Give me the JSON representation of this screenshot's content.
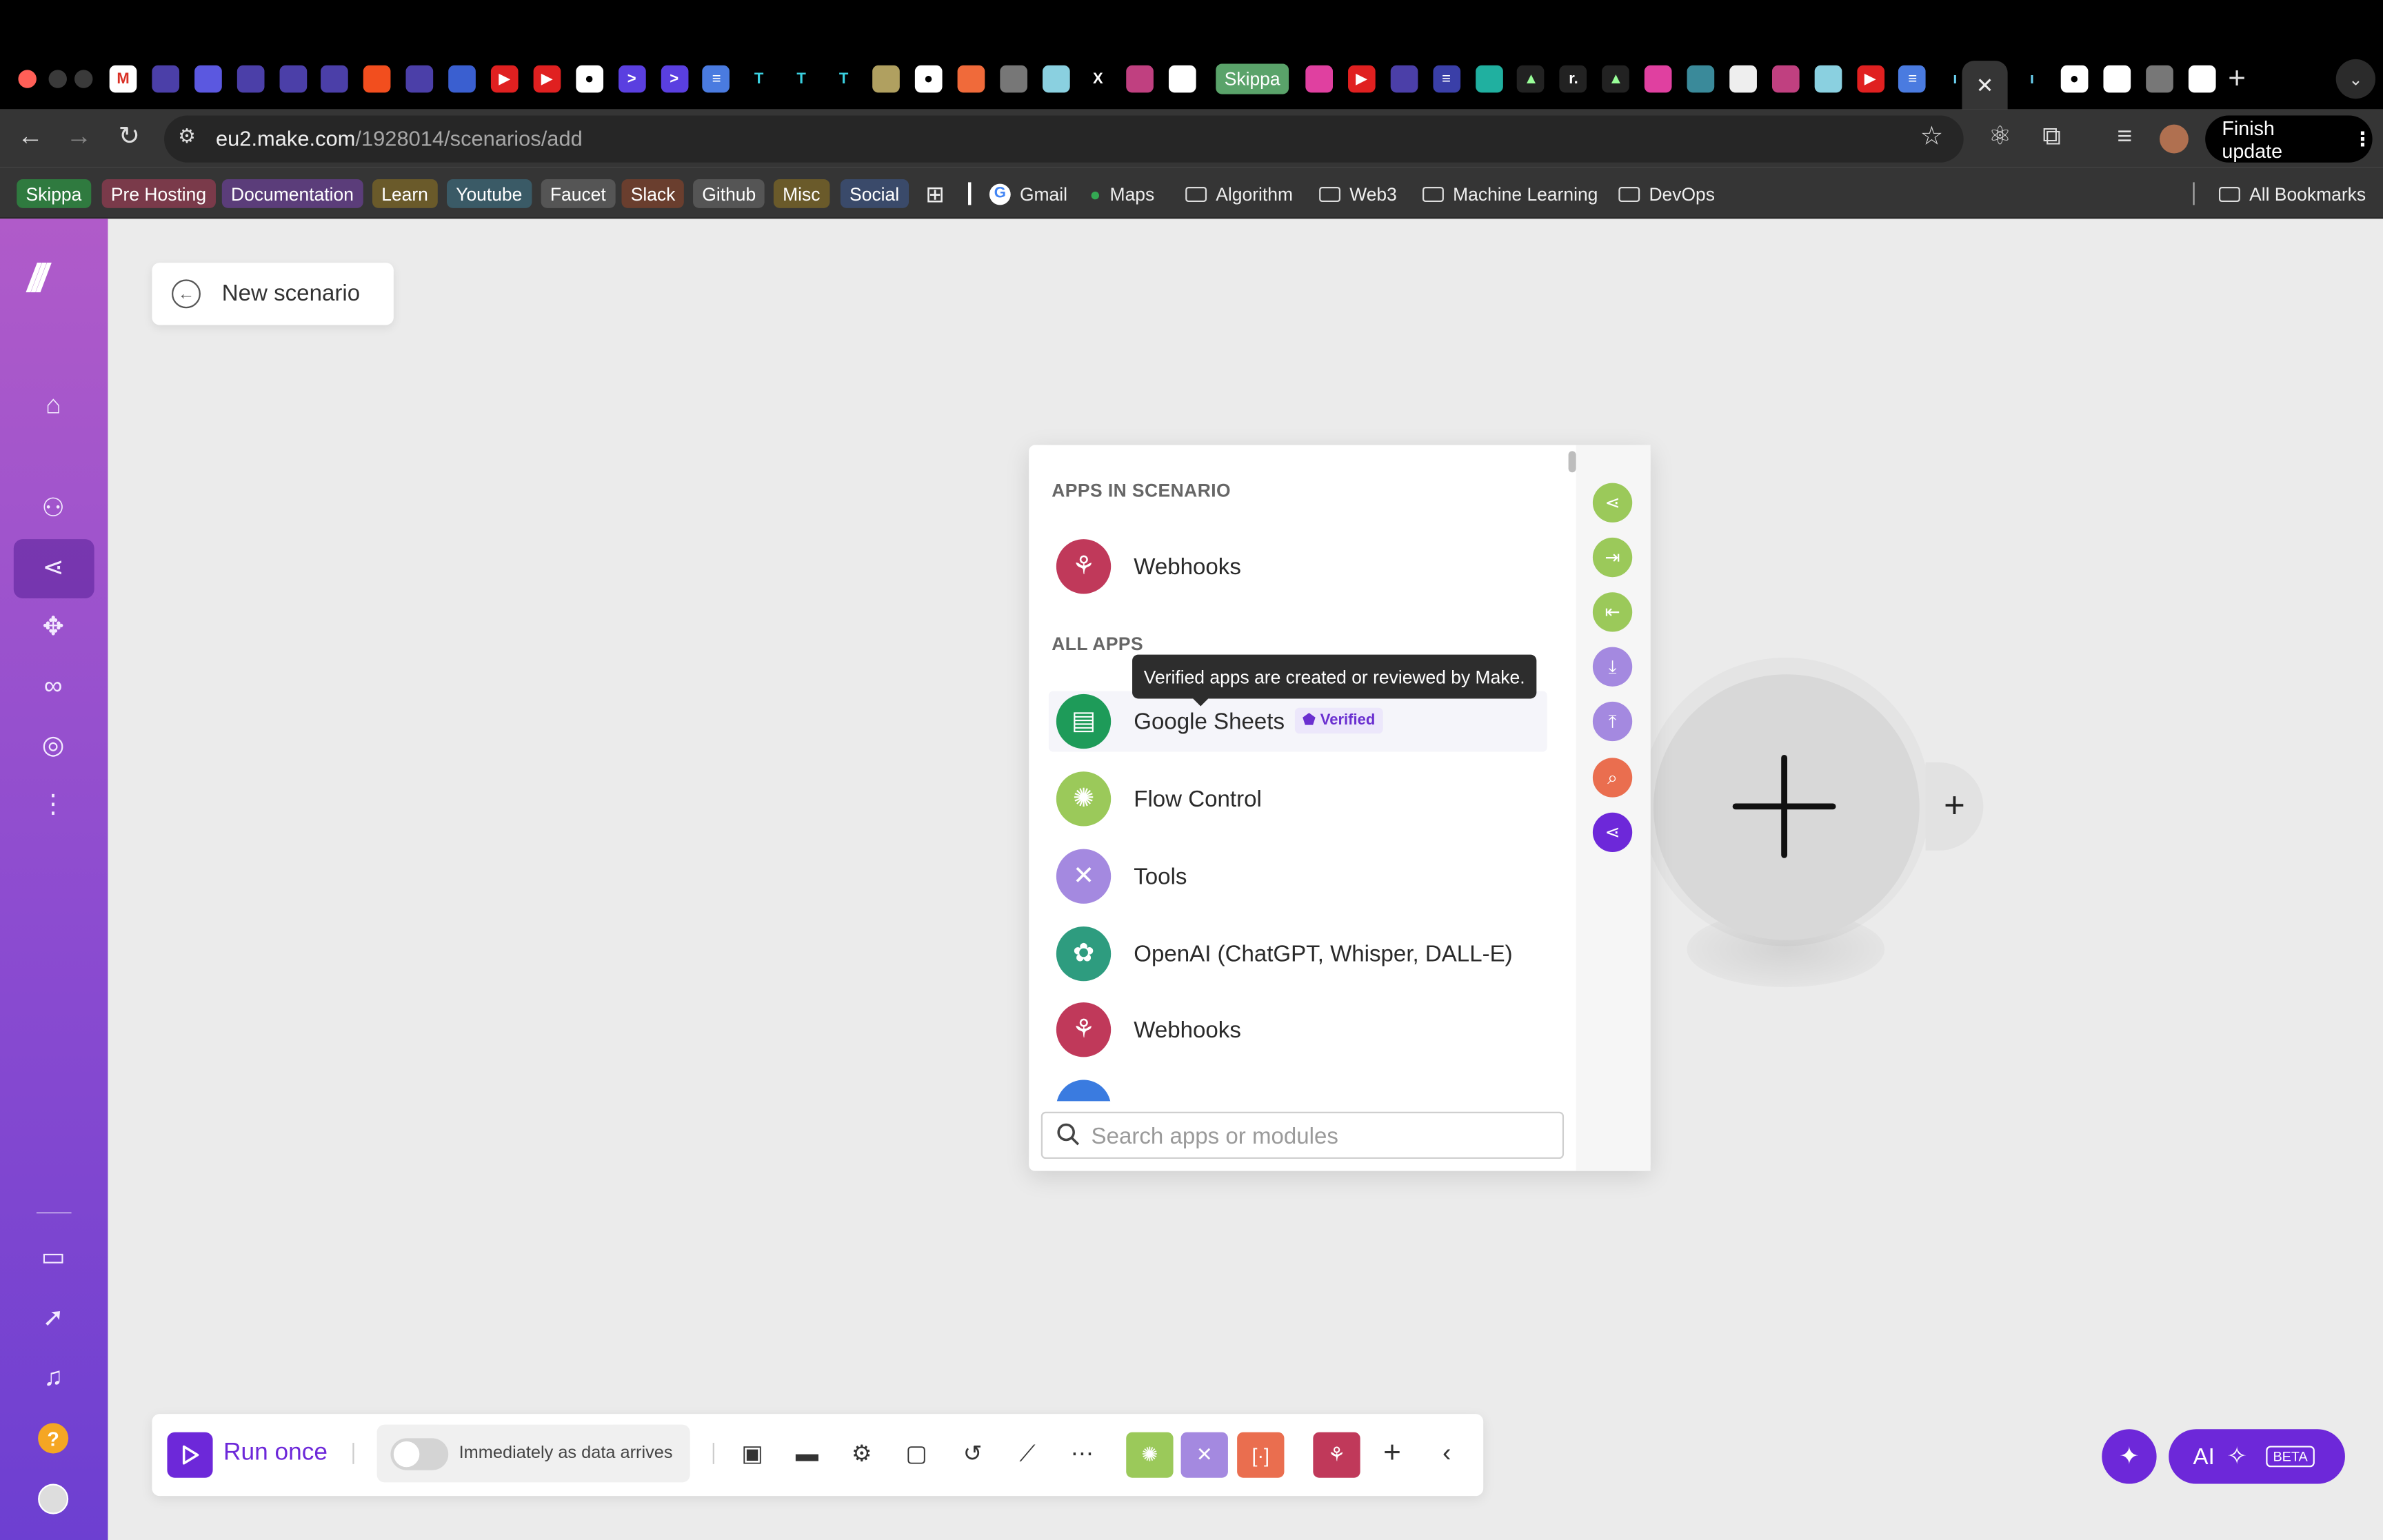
{
  "browser": {
    "url_host": "eu2.make.com",
    "url_path": "/1928014/scenarios/add",
    "finish_update_label": "Finish update",
    "tab_badge": "Skippa",
    "bookmarks": [
      {
        "label": "Skippa",
        "color": "#2f7a3f"
      },
      {
        "label": "Pre Hosting",
        "color": "#7a3a4a"
      },
      {
        "label": "Documentation",
        "color": "#5b3d7a"
      },
      {
        "label": "Learn",
        "color": "#6a5a2a"
      },
      {
        "label": "Youtube",
        "color": "#3a5a66"
      },
      {
        "label": "Faucet",
        "color": "#555555"
      },
      {
        "label": "Slack",
        "color": "#6a3e2e"
      },
      {
        "label": "Github",
        "color": "#555555"
      },
      {
        "label": "Misc",
        "color": "#6a5a2a"
      },
      {
        "label": "Social",
        "color": "#3a4a6a"
      }
    ],
    "bookmark_links": [
      "Gmail",
      "Maps"
    ],
    "bookmark_folders": [
      "Algorithm",
      "Web3",
      "Machine Learning",
      "DevOps"
    ],
    "all_bookmarks_label": "All Bookmarks"
  },
  "scenario": {
    "back_label": "New scenario"
  },
  "picker": {
    "apps_in_scenario_heading": "APPS IN SCENARIO",
    "all_apps_heading": "ALL APPS",
    "scenario_apps": [
      {
        "name": "Webhooks",
        "icon": "webhook-icon",
        "color": "#c0395a"
      }
    ],
    "apps": [
      {
        "name": "Google Sheets",
        "icon": "sheets-icon",
        "color": "#1e9b59",
        "verified": true
      },
      {
        "name": "Flow Control",
        "icon": "gear-icon",
        "color": "#9bc95a"
      },
      {
        "name": "Tools",
        "icon": "tools-icon",
        "color": "#a489e0"
      },
      {
        "name": "OpenAI (ChatGPT, Whisper, DALL-E)",
        "icon": "openai-icon",
        "color": "#2e9c7f"
      },
      {
        "name": "Webhooks",
        "icon": "webhook-icon",
        "color": "#c0395a"
      }
    ],
    "verified_label": "Verified",
    "tooltip": "Verified apps are created or reviewed by Make.",
    "search_placeholder": "Search apps or modules"
  },
  "toolbar": {
    "run_once_label": "Run once",
    "schedule_label": "Immediately as data arrives",
    "schedule_enabled": false,
    "icons": [
      "save-icon",
      "explain-flow-icon",
      "settings-icon",
      "notes-icon",
      "undo-icon",
      "magic-wand-icon",
      "more-icon"
    ],
    "favorite_apps": [
      {
        "icon": "flow-control-icon",
        "color": "#9bc95a"
      },
      {
        "icon": "tools-icon",
        "color": "#a489e0"
      },
      {
        "icon": "text-parser-icon",
        "color": "#ea6e4f"
      },
      {
        "icon": "webhook-icon",
        "color": "#c0395a"
      }
    ]
  },
  "assistant": {
    "ai_label": "AI",
    "beta_label": "BETA"
  },
  "colors": {
    "accent": "#6d28d9",
    "sidebar_top": "#b05bc9",
    "sidebar_bottom": "#6d3fd1",
    "canvas": "#ebebeb"
  }
}
